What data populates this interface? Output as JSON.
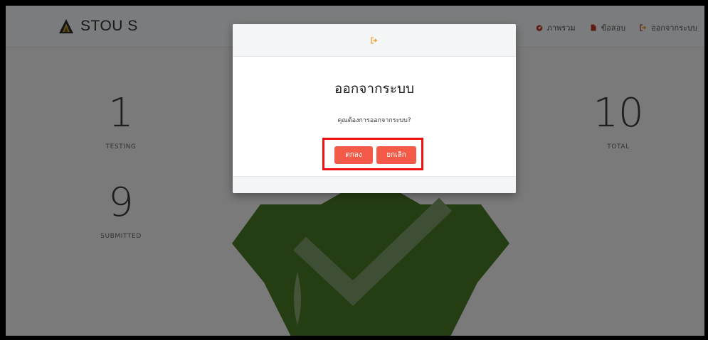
{
  "brand": {
    "name": "STOU S"
  },
  "nav": {
    "items": [
      {
        "label": "ภาพรวม",
        "icon": "dashboard-icon"
      },
      {
        "label": "ข้อสอบ",
        "icon": "file-icon"
      },
      {
        "label": "ออกจากระบบ",
        "icon": "sign-out-icon"
      }
    ]
  },
  "stats": {
    "testing": {
      "value": "1",
      "label": "TESTING"
    },
    "submitted": {
      "value": "9",
      "label": "SUBMITTED"
    },
    "total": {
      "value": "10",
      "label": "TOTAL"
    }
  },
  "modal": {
    "header_icon": "sign-out-icon",
    "title": "ออกจากระบบ",
    "message": "คุณต้องการออกจากระบบ?",
    "confirm_label": "ตกลง",
    "cancel_label": "ยกเลิก"
  },
  "colors": {
    "accent_button": "#f35b48",
    "highlight_border": "#ee1111",
    "badge_green": "#4a7a26",
    "icon_red": "#c0392b",
    "icon_orange": "#f0a030"
  }
}
